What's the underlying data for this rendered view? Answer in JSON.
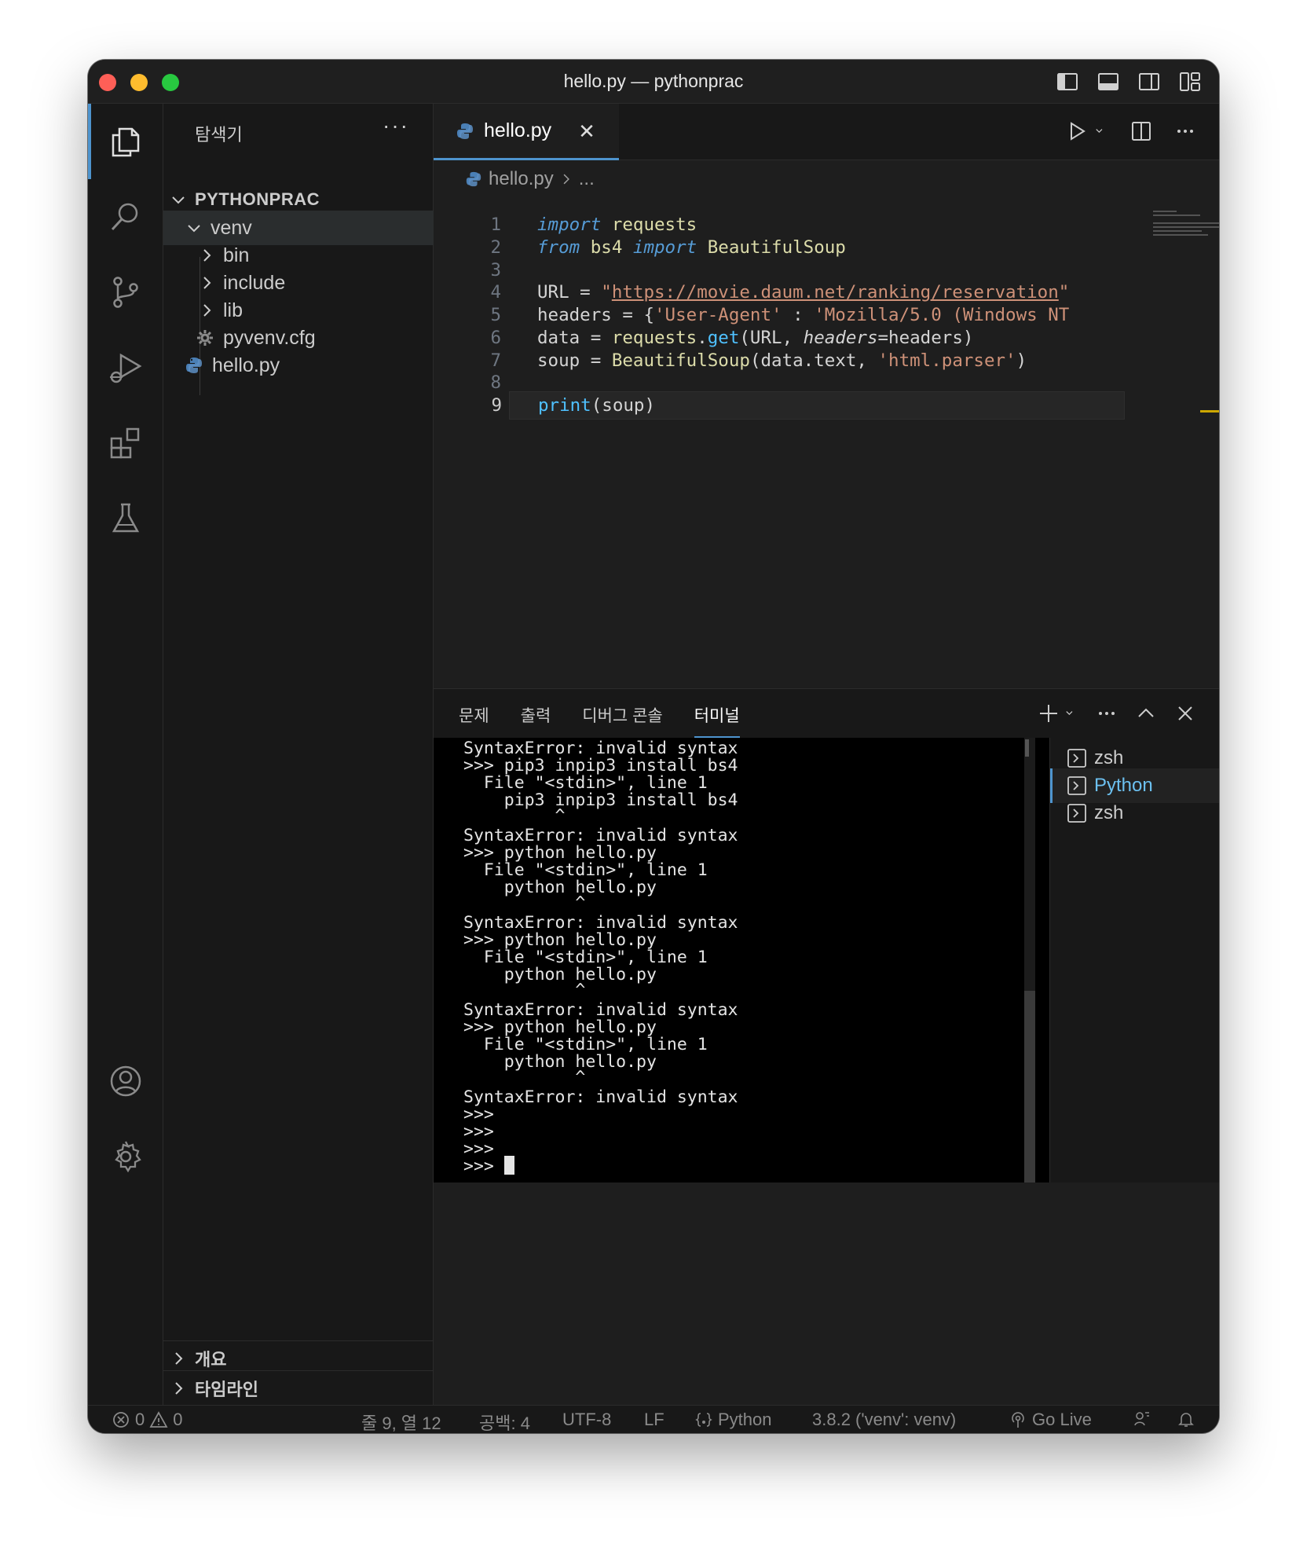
{
  "window": {
    "title": "hello.py — pythonprac"
  },
  "activity_bar": {
    "items": [
      "explorer",
      "search",
      "source-control",
      "run-and-debug",
      "extensions",
      "testing",
      "accounts",
      "manage"
    ]
  },
  "sidebar": {
    "title": "탐색기",
    "more": "···",
    "project": "PYTHONPRAC",
    "tree": [
      {
        "label": "venv",
        "kind": "folder-open"
      },
      {
        "label": "bin",
        "kind": "folder"
      },
      {
        "label": "include",
        "kind": "folder"
      },
      {
        "label": "lib",
        "kind": "folder"
      },
      {
        "label": "pyvenv.cfg",
        "kind": "config"
      },
      {
        "label": "hello.py",
        "kind": "python"
      }
    ],
    "sections": [
      {
        "label": "개요"
      },
      {
        "label": "타임라인"
      }
    ]
  },
  "editor": {
    "tab": {
      "label": "hello.py"
    },
    "breadcrumb": {
      "file": "hello.py",
      "rest": "..."
    },
    "line_numbers": [
      "1",
      "2",
      "3",
      "4",
      "5",
      "6",
      "7",
      "8",
      "9"
    ],
    "lines": {
      "l1": {
        "kw": "import",
        "mod": " requests"
      },
      "l2": {
        "kw1": "from",
        "mod": " bs4 ",
        "kw2": "import",
        "cls": " BeautifulSoup"
      },
      "l4": {
        "var": "URL",
        "op": " = ",
        "q1": "\"",
        "url": "https://movie.daum.net/ranking/reservation",
        "q2": "\""
      },
      "l5": {
        "var": "headers",
        "op": " = {",
        "str1": "'User-Agent'",
        "op2": " : ",
        "str2": "'Mozilla/5.0 (Windows NT"
      },
      "l6": {
        "var": "data",
        "op": " = ",
        "obj": "requests",
        "dot": ".",
        "fn": "get",
        "p1": "(URL, ",
        "param": "headers",
        "p2": "=headers)"
      },
      "l7": {
        "var": "soup",
        "op": " = ",
        "cls": "BeautifulSoup",
        "p1": "(data.text, ",
        "str": "'html.parser'",
        "p2": ")"
      },
      "l9": {
        "fn": "print",
        "p": "(soup)"
      }
    }
  },
  "panel": {
    "tabs": [
      "문제",
      "출력",
      "디버그 콘솔",
      "터미널"
    ],
    "active_tab": "터미널",
    "terminal_lines": [
      "SyntaxError: invalid syntax",
      ">>> pip3 inpip3 install bs4",
      "  File \"<stdin>\", line 1",
      "    pip3 inpip3 install bs4",
      "         ^",
      "SyntaxError: invalid syntax",
      ">>> python hello.py",
      "  File \"<stdin>\", line 1",
      "    python hello.py",
      "           ^",
      "SyntaxError: invalid syntax",
      ">>> python hello.py",
      "  File \"<stdin>\", line 1",
      "    python hello.py",
      "           ^",
      "SyntaxError: invalid syntax",
      ">>> python hello.py",
      "  File \"<stdin>\", line 1",
      "    python hello.py",
      "           ^",
      "SyntaxError: invalid syntax",
      ">>>",
      ">>>",
      ">>>",
      ">>> "
    ],
    "terminals": [
      {
        "label": "zsh",
        "active": false
      },
      {
        "label": "Python",
        "active": true
      },
      {
        "label": "zsh",
        "active": false
      }
    ]
  },
  "statusbar": {
    "errors": "0",
    "warnings": "0",
    "position": "줄 9, 열 12",
    "spaces": "공백: 4",
    "encoding": "UTF-8",
    "eol": "LF",
    "language": "Python",
    "interpreter": "3.8.2 ('venv': venv)",
    "golive": "Go Live"
  },
  "colors": {
    "accent": "#4e94ce",
    "editor_bg": "#1e1e1e",
    "terminal_bg": "#000000"
  }
}
